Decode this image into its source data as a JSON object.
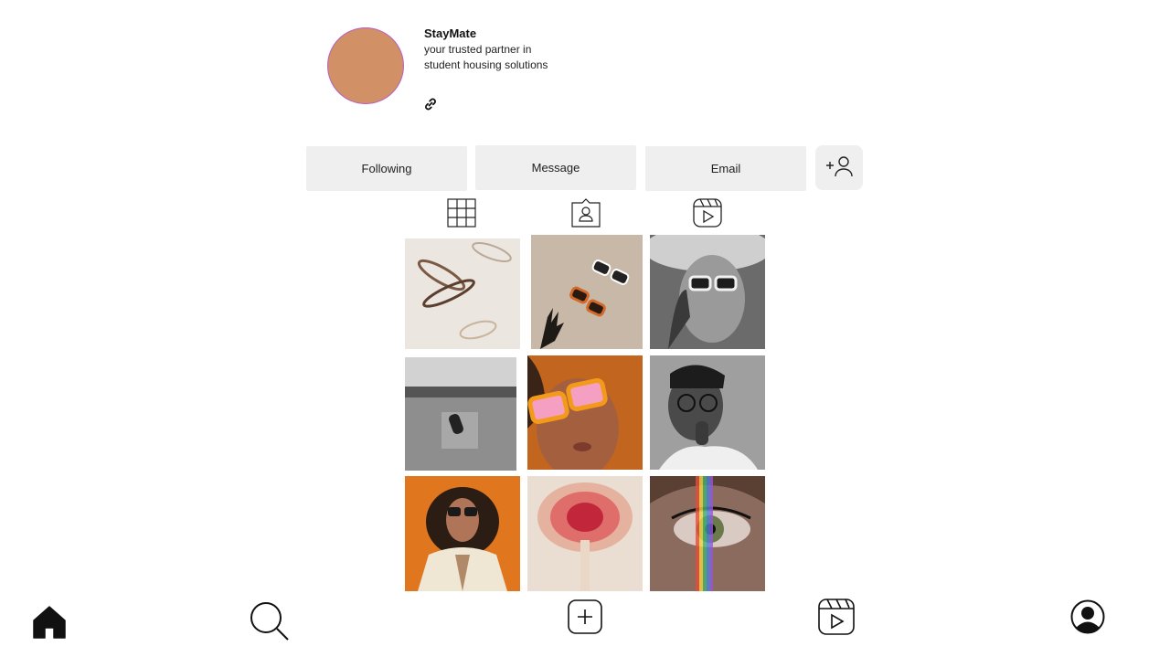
{
  "profile": {
    "name": "StayMate",
    "bio": "your trusted partner in student housing solutions",
    "avatar_color": "#d19066"
  },
  "actions": {
    "following_label": "Following",
    "message_label": "Message",
    "email_label": "Email"
  },
  "icons": {
    "link": "link-icon",
    "add_user": "add-user-icon",
    "grid_tab": "grid-icon",
    "tagged_tab": "tagged-icon",
    "reels_tab": "reels-icon",
    "home": "home-icon",
    "search": "search-icon",
    "create": "plus-square-icon",
    "reels": "reels-icon",
    "profile": "profile-icon"
  },
  "posts": [
    {
      "subject": "eyeglasses flat lay"
    },
    {
      "subject": "sunglasses on sand"
    },
    {
      "subject": "woman in white sunglasses"
    },
    {
      "subject": "sunglasses in jeans pocket"
    },
    {
      "subject": "woman in orange sunglasses"
    },
    {
      "subject": "man with glasses"
    },
    {
      "subject": "woman on orange backdrop"
    },
    {
      "subject": "blurred red flower"
    },
    {
      "subject": "eye with rainbow light"
    }
  ]
}
